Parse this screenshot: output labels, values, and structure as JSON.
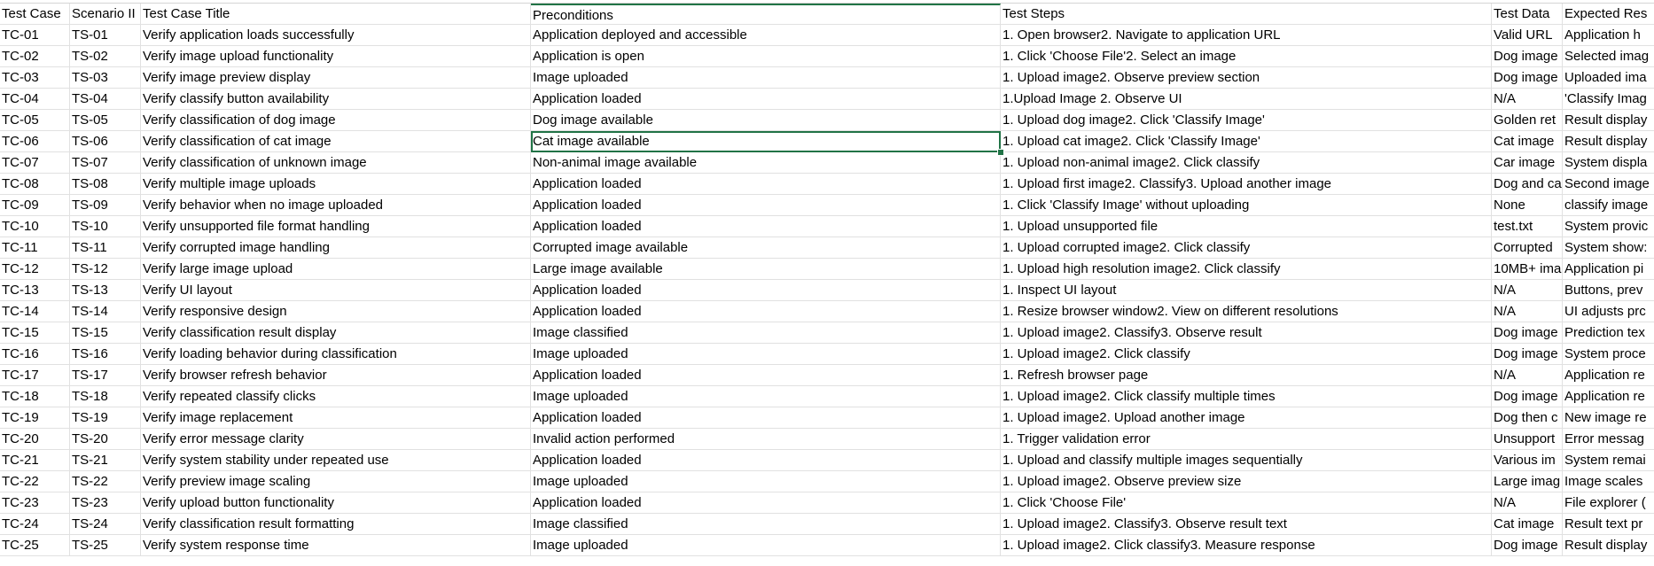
{
  "sheet": {
    "headers": [
      "Test Case",
      "Scenario II",
      "Test Case Title",
      "Preconditions",
      "Test Steps",
      "Test Data",
      "Expected Res"
    ],
    "rows": [
      [
        "TC-01",
        "TS-01",
        "Verify application loads successfully",
        "Application deployed and accessible",
        "1. Open browser2. Navigate to application URL",
        "Valid URL",
        "Application h"
      ],
      [
        "TC-02",
        "TS-02",
        "Verify image upload functionality",
        "Application is open",
        "1. Click 'Choose File'2. Select an image",
        "Dog image",
        "Selected imag"
      ],
      [
        "TC-03",
        "TS-03",
        "Verify image preview display",
        "Image uploaded",
        "1. Upload image2. Observe preview section",
        "Dog image",
        "Uploaded ima"
      ],
      [
        "TC-04",
        "TS-04",
        "Verify classify button availability",
        "Application loaded",
        "1.Upload Image 2. Observe UI",
        "N/A",
        "'Classify Imag"
      ],
      [
        "TC-05",
        "TS-05",
        "Verify classification of dog image",
        "Dog image available",
        "1. Upload dog image2. Click 'Classify Image'",
        "Golden ret",
        "Result display"
      ],
      [
        "TC-06",
        "TS-06",
        "Verify classification of cat image",
        "Cat image available",
        "1. Upload cat image2. Click 'Classify Image'",
        "Cat image",
        "Result display"
      ],
      [
        "TC-07",
        "TS-07",
        "Verify classification of unknown image",
        "Non-animal image available",
        "1. Upload non-animal image2. Click classify",
        "Car image",
        "System displa"
      ],
      [
        "TC-08",
        "TS-08",
        "Verify multiple image uploads",
        "Application loaded",
        "1. Upload first image2. Classify3. Upload another image",
        "Dog and ca",
        "Second image"
      ],
      [
        "TC-09",
        "TS-09",
        "Verify behavior when no image uploaded",
        "Application loaded",
        "1. Click 'Classify Image' without uploading",
        "None",
        "classify image"
      ],
      [
        "TC-10",
        "TS-10",
        "Verify unsupported file format handling",
        "Application loaded",
        "1. Upload unsupported file",
        "test.txt",
        "System provic"
      ],
      [
        "TC-11",
        "TS-11",
        "Verify corrupted image handling",
        "Corrupted image available",
        "1. Upload corrupted image2. Click classify",
        "Corrupted",
        "System show:"
      ],
      [
        "TC-12",
        "TS-12",
        "Verify large image upload",
        "Large image available",
        "1. Upload high resolution image2. Click classify",
        "10MB+ ima",
        "Application pi"
      ],
      [
        "TC-13",
        "TS-13",
        "Verify UI layout",
        "Application loaded",
        "1. Inspect UI layout",
        "N/A",
        "Buttons, prev"
      ],
      [
        "TC-14",
        "TS-14",
        "Verify responsive design",
        "Application loaded",
        "1. Resize browser window2. View on different resolutions",
        "N/A",
        "UI adjusts prc"
      ],
      [
        "TC-15",
        "TS-15",
        "Verify classification result display",
        "Image classified",
        "1. Upload image2. Classify3. Observe result",
        "Dog image",
        "Prediction tex"
      ],
      [
        "TC-16",
        "TS-16",
        "Verify loading behavior during classification",
        "Image uploaded",
        "1. Upload image2. Click classify",
        "Dog image",
        "System proce"
      ],
      [
        "TC-17",
        "TS-17",
        "Verify browser refresh behavior",
        "Application loaded",
        "1. Refresh browser page",
        "N/A",
        "Application re"
      ],
      [
        "TC-18",
        "TS-18",
        "Verify repeated classify clicks",
        "Image uploaded",
        "1. Upload image2. Click classify multiple times",
        "Dog image",
        "Application re"
      ],
      [
        "TC-19",
        "TS-19",
        "Verify image replacement",
        "Application loaded",
        "1. Upload image2. Upload another image",
        "Dog then c",
        "New image re"
      ],
      [
        "TC-20",
        "TS-20",
        "Verify error message clarity",
        "Invalid action performed",
        "1. Trigger validation error",
        "Unsupport",
        "Error messag"
      ],
      [
        "TC-21",
        "TS-21",
        "Verify system stability under repeated use",
        "Application loaded",
        "1. Upload and classify multiple images sequentially",
        "Various im",
        "System remai"
      ],
      [
        "TC-22",
        "TS-22",
        "Verify preview image scaling",
        "Image uploaded",
        "1. Upload image2. Observe preview size",
        "Large imag",
        "Image scales"
      ],
      [
        "TC-23",
        "TS-23",
        "Verify upload button functionality",
        "Application loaded",
        "1. Click 'Choose File'",
        "N/A",
        "File explorer ("
      ],
      [
        "TC-24",
        "TS-24",
        "Verify classification result formatting",
        "Image classified",
        "1. Upload image2. Classify3. Observe result text",
        "Cat image",
        "Result text pr"
      ],
      [
        "TC-25",
        "TS-25",
        "Verify system response time",
        "Image uploaded",
        "1. Upload image2. Click classify3. Measure response",
        "Dog image",
        "Result display"
      ]
    ]
  },
  "colors": {
    "selection": "#217346",
    "gridline": "#e1e1e1"
  }
}
